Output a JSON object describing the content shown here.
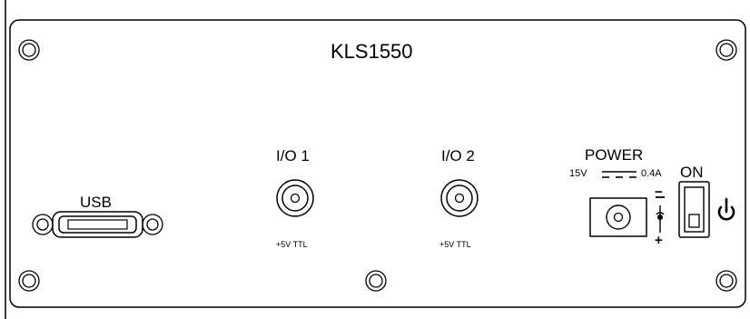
{
  "panel": {
    "title": "KLS1550",
    "usb": {
      "label": "USB"
    },
    "io1": {
      "label": "I/O 1",
      "note": "+5V TTL"
    },
    "io2": {
      "label": "I/O 2",
      "note": "+5V TTL"
    },
    "power": {
      "label": "POWER",
      "voltage": "15V",
      "current": "0.4A",
      "polarity_minus": "−",
      "polarity_plus": "+"
    },
    "switch": {
      "label": "ON",
      "icon": "power-icon"
    }
  }
}
